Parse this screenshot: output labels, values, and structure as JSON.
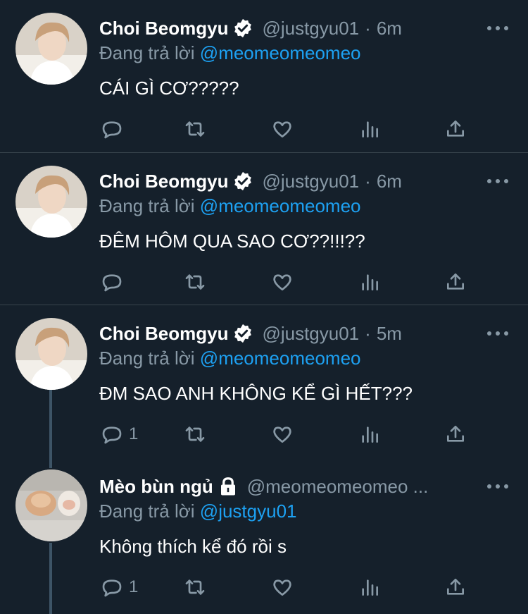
{
  "tweets": [
    {
      "name": "Choi Beomgyu",
      "verified": true,
      "handle": "@justgyu01",
      "dot": "·",
      "time": "6m",
      "reply_prefix": "Đang trả lời",
      "reply_to": "@meomeomeomeo",
      "text": "CÁI GÌ CƠ?????",
      "reply_count": ""
    },
    {
      "name": "Choi Beomgyu",
      "verified": true,
      "handle": "@justgyu01",
      "dot": "·",
      "time": "6m",
      "reply_prefix": "Đang trả lời",
      "reply_to": "@meomeomeomeo",
      "text": "ĐÊM HÔM QUA SAO CƠ??!!!??",
      "reply_count": ""
    },
    {
      "name": "Choi Beomgyu",
      "verified": true,
      "handle": "@justgyu01",
      "dot": "·",
      "time": "5m",
      "reply_prefix": "Đang trả lời",
      "reply_to": "@meomeomeomeo",
      "text": "ĐM SAO ANH KHÔNG KỂ GÌ HẾT???",
      "reply_count": "1"
    },
    {
      "name": "Mèo bùn ngủ",
      "locked": true,
      "handle": "@meomeomeomeo ...",
      "reply_prefix": "Đang trả lời",
      "reply_to": "@justgyu01",
      "text": "Không thích kể đó rồi s",
      "reply_count": "1"
    }
  ],
  "colors": {
    "background": "#15202b",
    "secondary_text": "#8899a6",
    "link": "#1da1f2",
    "divider": "#38444d",
    "thread_line": "#3d5466"
  },
  "icons": [
    "reply-icon",
    "retweet-icon",
    "like-icon",
    "analytics-icon",
    "share-icon",
    "verified-badge-icon",
    "lock-icon",
    "more-icon"
  ]
}
